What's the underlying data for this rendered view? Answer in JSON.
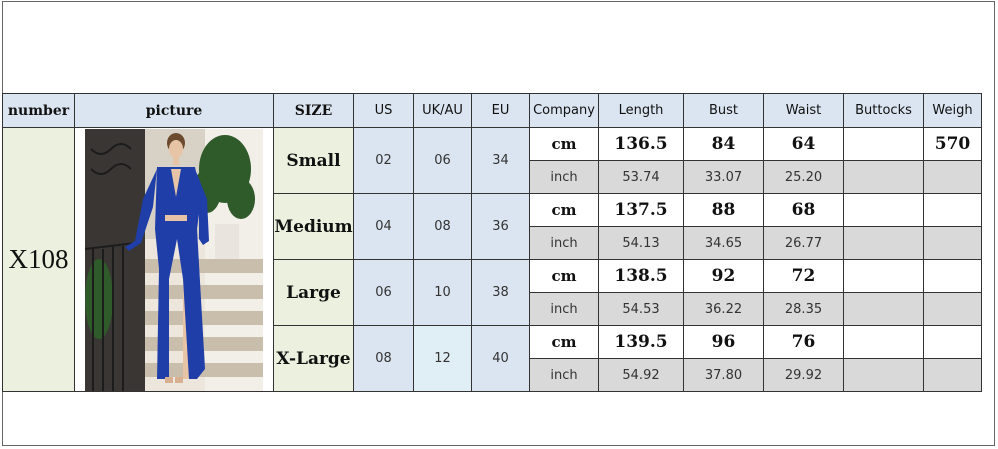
{
  "table": {
    "headers": [
      "number",
      "picture",
      "SIZE",
      "US",
      "UK/AU",
      "EU",
      "Company",
      "Length",
      "Bust",
      "Waist",
      "Buttocks",
      "Weigh"
    ],
    "number": "X108",
    "units": {
      "cm": "cm",
      "inch": "inch"
    },
    "rows": [
      {
        "size": "Small",
        "us": "02",
        "uk": "06",
        "eu": "34",
        "cm": {
          "length": "136.5",
          "bust": "84",
          "waist": "64",
          "buttocks": "",
          "weight": "570"
        },
        "inch": {
          "length": "53.74",
          "bust": "33.07",
          "waist": "25.20"
        }
      },
      {
        "size": "Medium",
        "us": "04",
        "uk": "08",
        "eu": "36",
        "cm": {
          "length": "137.5",
          "bust": "88",
          "waist": "68",
          "buttocks": "",
          "weight": ""
        },
        "inch": {
          "length": "54.13",
          "bust": "34.65",
          "waist": "26.77"
        }
      },
      {
        "size": "Large",
        "us": "06",
        "uk": "10",
        "eu": "38",
        "cm": {
          "length": "138.5",
          "bust": "92",
          "waist": "72",
          "buttocks": "",
          "weight": ""
        },
        "inch": {
          "length": "54.53",
          "bust": "36.22",
          "waist": "28.35"
        }
      },
      {
        "size": "X-Large",
        "us": "08",
        "uk": "12",
        "eu": "40",
        "cm": {
          "length": "139.5",
          "bust": "96",
          "waist": "76",
          "buttocks": "",
          "weight": ""
        },
        "inch": {
          "length": "54.92",
          "bust": "37.80",
          "waist": "29.92"
        }
      }
    ]
  },
  "colors": {
    "header_bg": "#dbe5f1",
    "size_bg": "#ebf1de",
    "inch_row_bg": "#d9d9d9",
    "dress": "#1f3ea8"
  }
}
